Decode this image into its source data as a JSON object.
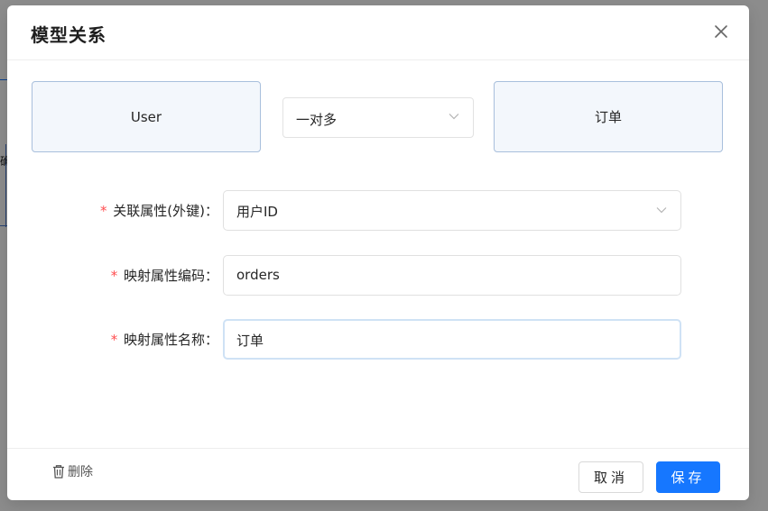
{
  "modal": {
    "title": "模型关系",
    "close_icon": "close-icon"
  },
  "relation": {
    "source_entity": "User",
    "relation_type": "一对多",
    "target_entity": "订单"
  },
  "form": {
    "required_mark": "*",
    "fields": [
      {
        "label": "关联属性(外键)：",
        "value": "用户ID",
        "type": "select"
      },
      {
        "label": "映射属性编码：",
        "value": "orders",
        "type": "input"
      },
      {
        "label": "映射属性名称：",
        "value": "订单",
        "type": "input",
        "focused": true
      }
    ]
  },
  "footer": {
    "delete_label": "删除",
    "delete_icon": "trash-icon",
    "cancel_label": "取消",
    "save_label": "保存"
  },
  "background": {
    "fragment_text": "确"
  },
  "colors": {
    "primary": "#1677ff",
    "required": "#ff4d4f",
    "entity_bg": "#f3f7fc",
    "entity_border": "#a8bfdc"
  }
}
